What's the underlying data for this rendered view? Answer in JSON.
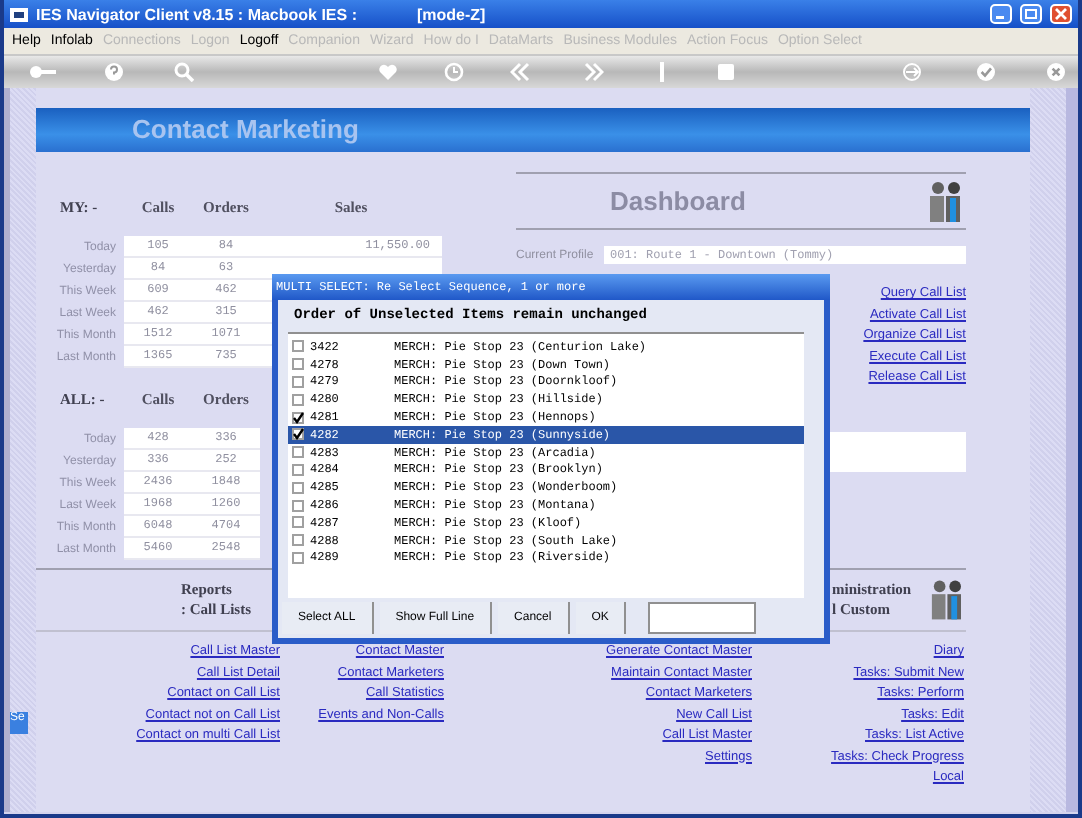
{
  "window": {
    "title": "IES Navigator Client v8.15 : Macbook IES :",
    "mode": "[mode-Z]"
  },
  "menu": [
    {
      "label": "Help",
      "disabled": false
    },
    {
      "label": "Infolab",
      "disabled": false
    },
    {
      "label": "Connections",
      "disabled": true
    },
    {
      "label": "Logon",
      "disabled": true
    },
    {
      "label": "Logoff",
      "disabled": false
    },
    {
      "label": "Companion",
      "disabled": true
    },
    {
      "label": "Wizard",
      "disabled": true
    },
    {
      "label": "How do I",
      "disabled": true
    },
    {
      "label": "DataMarts",
      "disabled": true
    },
    {
      "label": "Business Modules",
      "disabled": true
    },
    {
      "label": "Action Focus",
      "disabled": true
    },
    {
      "label": "Option Select",
      "disabled": true
    }
  ],
  "header": {
    "title": "Contact Marketing"
  },
  "my_stats": {
    "label": "MY: -",
    "columns": [
      "Calls",
      "Orders",
      "Sales"
    ],
    "rows": [
      {
        "label": "Today",
        "calls": "105",
        "orders": "84",
        "sales": "11,550.00"
      },
      {
        "label": "Yesterday",
        "calls": "84",
        "orders": "63"
      },
      {
        "label": "This Week",
        "calls": "609",
        "orders": "462"
      },
      {
        "label": "Last Week",
        "calls": "462",
        "orders": "315"
      },
      {
        "label": "This Month",
        "calls": "1512",
        "orders": "1071"
      },
      {
        "label": "Last Month",
        "calls": "1365",
        "orders": "735"
      }
    ]
  },
  "all_stats": {
    "label": "ALL: -",
    "columns": [
      "Calls",
      "Orders"
    ],
    "rows": [
      {
        "label": "Today",
        "calls": "428",
        "orders": "336"
      },
      {
        "label": "Yesterday",
        "calls": "336",
        "orders": "252"
      },
      {
        "label": "This Week",
        "calls": "2436",
        "orders": "1848"
      },
      {
        "label": "Last Week",
        "calls": "1968",
        "orders": "1260"
      },
      {
        "label": "This Month",
        "calls": "6048",
        "orders": "4704"
      },
      {
        "label": "Last Month",
        "calls": "5460",
        "orders": "2548"
      }
    ]
  },
  "dashboard": {
    "title": "Dashboard",
    "profile_label": "Current Profile",
    "profile_value": "001: Route 1 - Downtown (Tommy)",
    "links": [
      "Query Call List",
      "Activate Call List",
      "Organize Call List",
      "Execute Call List",
      "Release Call List"
    ]
  },
  "reports": {
    "title": "Reports",
    "subtitle": ": Call Lists"
  },
  "administration": {
    "title": "ministration",
    "subtitle": "l Custom"
  },
  "link_columns": [
    [
      "Call List Master",
      "Call List Detail",
      "Contact on Call List",
      "Contact not on Call List",
      "Contact on multi Call List"
    ],
    [
      "Contact Master",
      "Contact Marketers",
      "Call Statistics",
      "Events and Non-Calls"
    ],
    [
      "Generate Contact Master",
      "Maintain Contact Master",
      "Contact Marketers",
      "New Call List",
      "Call List Master",
      "Settings"
    ],
    [
      "Diary",
      "Tasks: Submit New",
      "Tasks: Perform",
      "Tasks: Edit",
      "Tasks: List Active",
      "Tasks: Check Progress",
      "Local"
    ]
  ],
  "side_tab": "Se",
  "dialog": {
    "title": "MULTI SELECT: Re Select Sequence, 1 or more",
    "subtitle": "Order of Unselected Items remain unchanged",
    "items": [
      {
        "code": "3422",
        "text": "MERCH: Pie Stop 23 (Centurion Lake)",
        "checked": false,
        "selected": false
      },
      {
        "code": "4278",
        "text": "MERCH: Pie Stop 23 (Down Town)",
        "checked": false,
        "selected": false
      },
      {
        "code": "4279",
        "text": "MERCH: Pie Stop 23 (Doornkloof)",
        "checked": false,
        "selected": false
      },
      {
        "code": "4280",
        "text": "MERCH: Pie Stop 23 (Hillside)",
        "checked": false,
        "selected": false
      },
      {
        "code": "4281",
        "text": "MERCH: Pie Stop 23 (Hennops)",
        "checked": true,
        "selected": false
      },
      {
        "code": "4282",
        "text": "MERCH: Pie Stop 23 (Sunnyside)",
        "checked": true,
        "selected": true
      },
      {
        "code": "4283",
        "text": "MERCH: Pie Stop 23 (Arcadia)",
        "checked": false,
        "selected": false
      },
      {
        "code": "4284",
        "text": "MERCH: Pie Stop 23 (Brooklyn)",
        "checked": false,
        "selected": false
      },
      {
        "code": "4285",
        "text": "MERCH: Pie Stop 23 (Wonderboom)",
        "checked": false,
        "selected": false
      },
      {
        "code": "4286",
        "text": "MERCH: Pie Stop 23 (Montana)",
        "checked": false,
        "selected": false
      },
      {
        "code": "4287",
        "text": "MERCH: Pie Stop 23 (Kloof)",
        "checked": false,
        "selected": false
      },
      {
        "code": "4288",
        "text": "MERCH: Pie Stop 23 (South Lake)",
        "checked": false,
        "selected": false
      },
      {
        "code": "4289",
        "text": "MERCH: Pie Stop 23 (Riverside)",
        "checked": false,
        "selected": false
      }
    ],
    "buttons": [
      "Select ALL",
      "Show Full Line",
      "Cancel",
      "OK"
    ]
  }
}
